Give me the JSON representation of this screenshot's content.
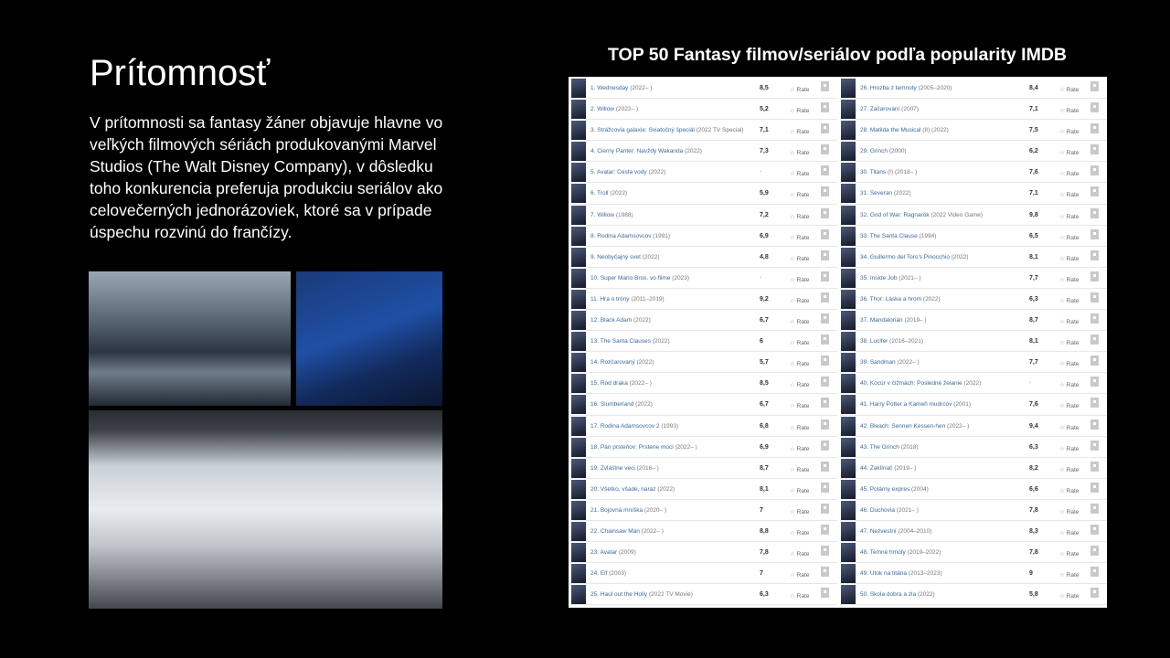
{
  "slide": {
    "title": "Prítomnosť",
    "body": "V prítomnosti sa fantasy žáner objavuje hlavne vo veľkých filmových sériách produkovanými Marvel Studios (The Walt Disney Company), v dôsledku toho konkurencia preferuja produkciu seriálov ako celovečerných jednorázoviek, ktoré sa v prípade úspechu rozvinú do frančízy.",
    "table_heading": "TOP 50 Fantasy filmov/seriálov podľa popularity IMDB"
  },
  "rate_label": "Rate",
  "rows_left": [
    {
      "title": "1. Wednesday",
      "year": "(2022– )",
      "rating": "8,5"
    },
    {
      "title": "2. Willow",
      "year": "(2022– )",
      "rating": "5,2"
    },
    {
      "title": "3. Strážcovia galaxie: Sviatočný špeciál",
      "year": "(2022 TV Special)",
      "rating": "7,1"
    },
    {
      "title": "4. Čierny Panter: Navždy Wakanda",
      "year": "(2022)",
      "rating": "7,3"
    },
    {
      "title": "5. Avatar: Cesta vody",
      "year": "(2022)",
      "rating": "-"
    },
    {
      "title": "6. Troll",
      "year": "(2022)",
      "rating": "5,9"
    },
    {
      "title": "7. Willow",
      "year": "(1988)",
      "rating": "7,2"
    },
    {
      "title": "8. Rodina Adamsovcov",
      "year": "(1991)",
      "rating": "6,9"
    },
    {
      "title": "9. Neobyčajný svet",
      "year": "(2022)",
      "rating": "4,8"
    },
    {
      "title": "10. Super Mario Bros. vo filme",
      "year": "(2023)",
      "rating": "-"
    },
    {
      "title": "11. Hra o tróny",
      "year": "(2011–2019)",
      "rating": "9,2"
    },
    {
      "title": "12. Black Adam",
      "year": "(2022)",
      "rating": "6,7"
    },
    {
      "title": "13. The Santa Clauses",
      "year": "(2022)",
      "rating": "6"
    },
    {
      "title": "14. Rozčarovaný",
      "year": "(2022)",
      "rating": "5,7"
    },
    {
      "title": "15. Rod draka",
      "year": "(2022– )",
      "rating": "8,5"
    },
    {
      "title": "16. Slumberland",
      "year": "(2022)",
      "rating": "6,7"
    },
    {
      "title": "17. Rodina Adamsovcov 2",
      "year": "(1993)",
      "rating": "6,8"
    },
    {
      "title": "18. Pán prsteňov: Prstene moci",
      "year": "(2022– )",
      "rating": "6,9"
    },
    {
      "title": "19. Zvláštne veci",
      "year": "(2016– )",
      "rating": "8,7"
    },
    {
      "title": "20. Všetko, všade, naraz",
      "year": "(2022)",
      "rating": "8,1"
    },
    {
      "title": "21. Bojovná mníška",
      "year": "(2020– )",
      "rating": "7"
    },
    {
      "title": "22. Chainsaw Man",
      "year": "(2022– )",
      "rating": "8,8"
    },
    {
      "title": "23. Avatar",
      "year": "(2009)",
      "rating": "7,8"
    },
    {
      "title": "24. Elf",
      "year": "(2003)",
      "rating": "7"
    },
    {
      "title": "25. Haul out the Holly",
      "year": "(2022 TV Movie)",
      "rating": "6,3"
    }
  ],
  "rows_right": [
    {
      "title": "26. Hrozba z temnoty",
      "year": "(2005–2020)",
      "rating": "8,4"
    },
    {
      "title": "27. Začarovaní",
      "year": "(2007)",
      "rating": "7,1"
    },
    {
      "title": "28. Matilda the Musical",
      "year": "(II) (2022)",
      "rating": "7,5"
    },
    {
      "title": "29. Grinch",
      "year": "(2000)",
      "rating": "6,2"
    },
    {
      "title": "30. Titans",
      "year": "(I) (2018– )",
      "rating": "7,6"
    },
    {
      "title": "31. Severan",
      "year": "(2022)",
      "rating": "7,1"
    },
    {
      "title": "32. God of War: Ragnarök",
      "year": "(2022 Video Game)",
      "rating": "9,8"
    },
    {
      "title": "33. The Santa Clause",
      "year": "(1994)",
      "rating": "6,5"
    },
    {
      "title": "34. Guillermo del Toro's Pinocchio",
      "year": "(2022)",
      "rating": "8,1"
    },
    {
      "title": "35. Inside Job",
      "year": "(2021– )",
      "rating": "7,7"
    },
    {
      "title": "36. Thor: Láska a hrom",
      "year": "(2022)",
      "rating": "6,3"
    },
    {
      "title": "37. Mandalorián",
      "year": "(2019– )",
      "rating": "8,7"
    },
    {
      "title": "38. Lucifer",
      "year": "(2016–2021)",
      "rating": "8,1"
    },
    {
      "title": "39. Sandman",
      "year": "(2022– )",
      "rating": "7,7"
    },
    {
      "title": "40. Kocúr v čižmách: Posledné želanie",
      "year": "(2022)",
      "rating": "-"
    },
    {
      "title": "41. Harry Potter a Kameň mudrcov",
      "year": "(2001)",
      "rating": "7,6"
    },
    {
      "title": "42. Bleach: Sennen Kessen-hen",
      "year": "(2022– )",
      "rating": "9,4"
    },
    {
      "title": "43. The Grinch",
      "year": "(2018)",
      "rating": "6,3"
    },
    {
      "title": "44. Zaklínač",
      "year": "(2019– )",
      "rating": "8,2"
    },
    {
      "title": "45. Polárny expres",
      "year": "(2004)",
      "rating": "6,6"
    },
    {
      "title": "46. Duchovia",
      "year": "(2021– )",
      "rating": "7,8"
    },
    {
      "title": "47. Nezvestní",
      "year": "(2004–2010)",
      "rating": "8,3"
    },
    {
      "title": "48. Temné hmoty",
      "year": "(2019–2022)",
      "rating": "7,8"
    },
    {
      "title": "49. Útok na titána",
      "year": "(2013–2023)",
      "rating": "9"
    },
    {
      "title": "50. Škola dobra a zla",
      "year": "(2022)",
      "rating": "5,8"
    }
  ]
}
